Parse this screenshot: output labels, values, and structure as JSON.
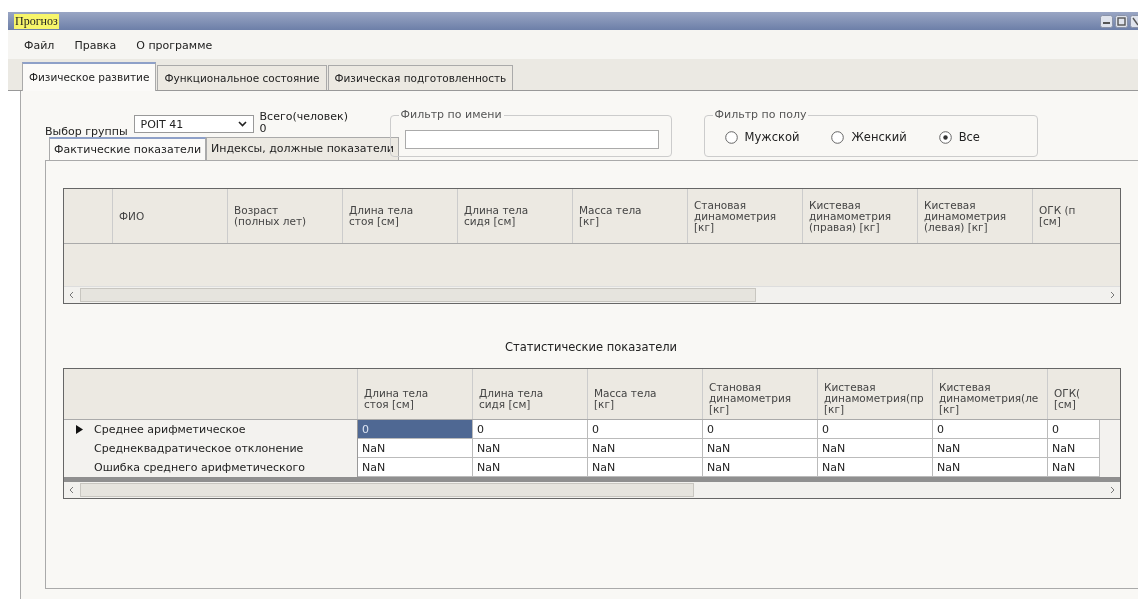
{
  "window": {
    "title": "Прогноз"
  },
  "menu": [
    "Файл",
    "Правка",
    "О программе"
  ],
  "tabs": [
    {
      "label": "Физическое развитие",
      "selected": true
    },
    {
      "label": "Функциональное состояние",
      "selected": false
    },
    {
      "label": "Физическая подготовленность",
      "selected": false
    }
  ],
  "group": {
    "label": "Выбор группы",
    "value": "POIT 41",
    "total_label": "Всего(человек)",
    "total": "0"
  },
  "name_filter": {
    "title": "Фильтр по имени"
  },
  "sex_filter": {
    "title": "Фильтр по полу",
    "options": [
      {
        "label": "Мужской",
        "selected": false
      },
      {
        "label": "Женский",
        "selected": false
      },
      {
        "label": "Все",
        "selected": true
      }
    ]
  },
  "subtabs": [
    {
      "label": "Фактические показатели",
      "selected": true
    },
    {
      "label": "Индексы, должные показатели",
      "selected": false
    }
  ],
  "people_table": {
    "columns": [
      "ФИО",
      "Возраст\n(полных лет)",
      "Длина тела\nстоя [см]",
      "Длина тела\nсидя [см]",
      "Масса тела\n[кг]",
      "Становая\nдинамометрия\n[кг]",
      "Кистевая\nдинамометрия\n(правая) [кг]",
      "Кистевая\nдинамометрия\n(левая) [кг]",
      "ОГК (п\n[см]"
    ]
  },
  "stats": {
    "title": "Статистические показатели",
    "columns": [
      "Длина тела\nстоя [см]",
      "Длина тела\nсидя [см]",
      "Масса тела\n[кг]",
      "Становая\nдинамометрия\n[кг]",
      "Кистевая\nдинамометрия(пр\n[кг]",
      "Кистевая\nдинамометрия(ле\n[кг]",
      "ОГК(\n[см]"
    ],
    "rows": [
      {
        "label": "Среднее арифметическое",
        "selected": true,
        "values": [
          "0",
          "0",
          "0",
          "0",
          "0",
          "0",
          "0"
        ]
      },
      {
        "label": "Среднеквадратическое отклонение",
        "selected": false,
        "values": [
          "NaN",
          "NaN",
          "NaN",
          "NaN",
          "NaN",
          "NaN",
          "NaN"
        ]
      },
      {
        "label": "Ошибка среднего арифметического",
        "selected": false,
        "values": [
          "NaN",
          "NaN",
          "NaN",
          "NaN",
          "NaN",
          "NaN",
          "NaN"
        ]
      }
    ]
  }
}
